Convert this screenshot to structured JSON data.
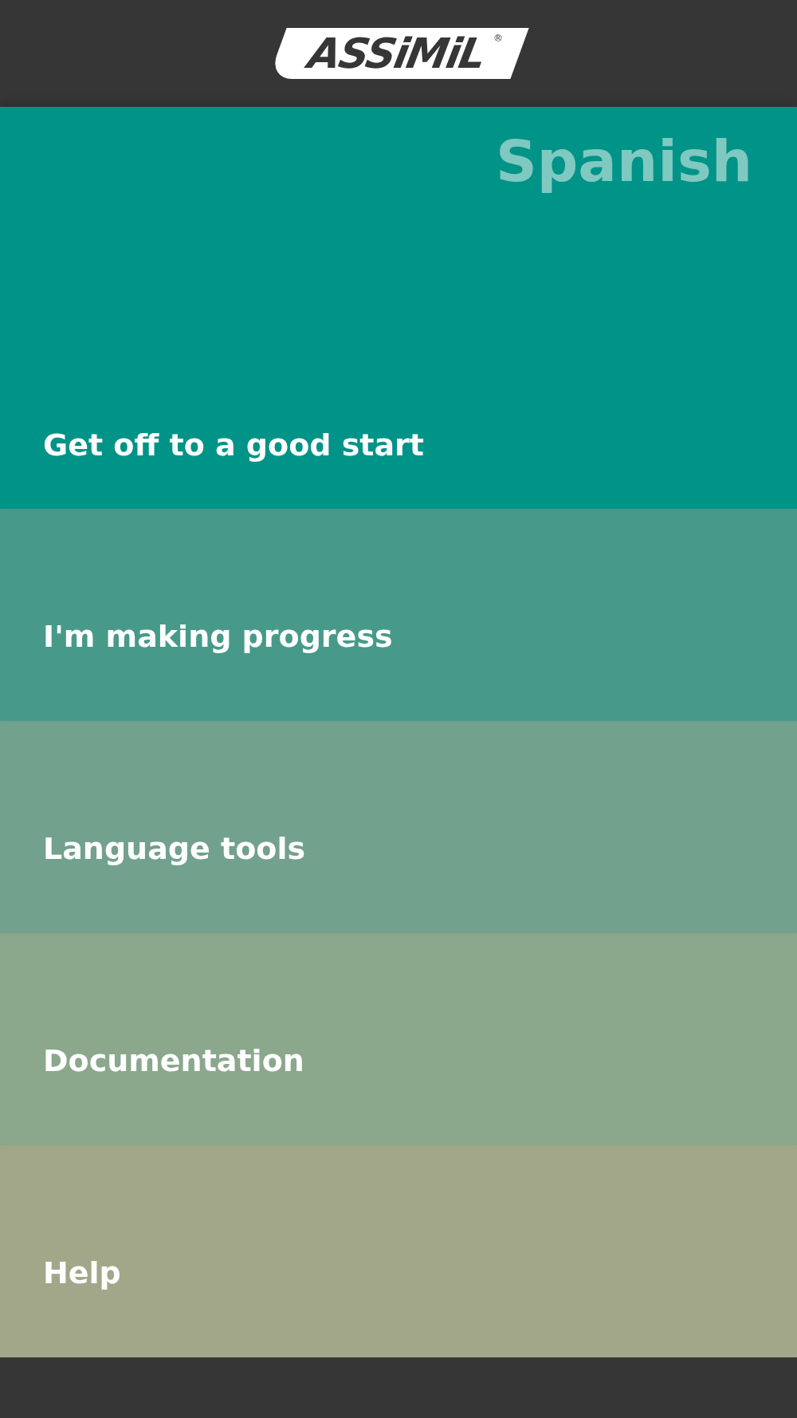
{
  "app_bar": {
    "logo": "ASSiMiL",
    "registered_mark": "®"
  },
  "course": {
    "title": "Spanish"
  },
  "menu": [
    {
      "label": "Get off to a good start",
      "color": "#009388"
    },
    {
      "label": "I'm making progress",
      "color": "#479a8a"
    },
    {
      "label": "Language tools",
      "color": "#72a18e"
    },
    {
      "label": "Documentation",
      "color": "#8ba78c"
    },
    {
      "label": "Help",
      "color": "#a2a78a"
    }
  ]
}
